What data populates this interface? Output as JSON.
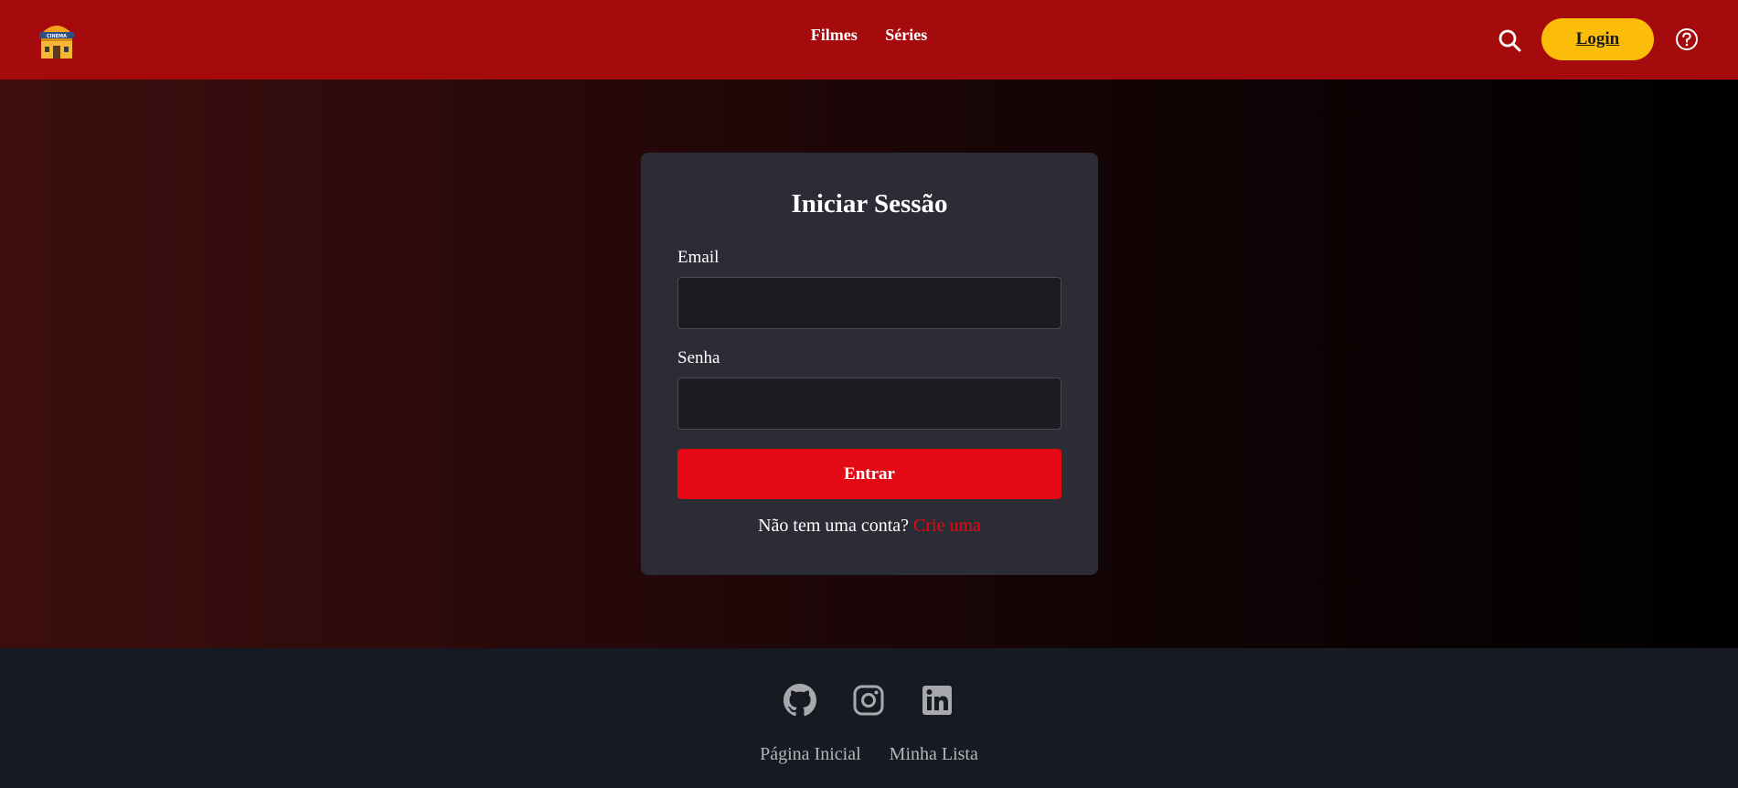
{
  "header": {
    "logo_text": "CINEMA",
    "nav": [
      "Filmes",
      "Séries"
    ],
    "login_label": "Login",
    "colors": {
      "background": "#a50b0c",
      "login_bg": "#fbbd0a"
    }
  },
  "login_card": {
    "title": "Iniciar Sessão",
    "email_label": "Email",
    "email_value": "",
    "password_label": "Senha",
    "password_value": "",
    "submit_label": "Entrar",
    "signup_prompt": "Não tem uma conta?",
    "signup_link": "Crie uma",
    "colors": {
      "card_bg": "#2b2c35",
      "submit_bg": "#e30a16",
      "link": "#e50914"
    }
  },
  "footer": {
    "social": [
      "github-icon",
      "instagram-icon",
      "linkedin-icon"
    ],
    "links": [
      "Página Inicial",
      "Minha Lista"
    ],
    "colors": {
      "background": "#161a22"
    }
  }
}
